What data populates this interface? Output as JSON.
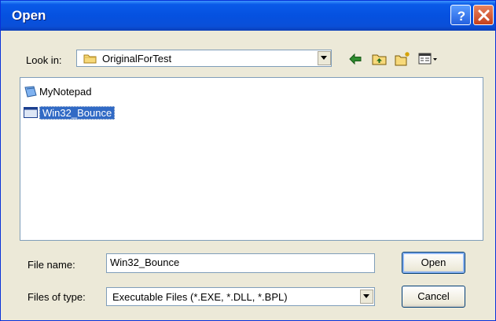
{
  "dialog": {
    "title": "Open",
    "look_in_label": "Look in:",
    "look_in_value": "OriginalForTest",
    "files": [
      {
        "name": "MyNotepad",
        "icon": "notepad-app-icon",
        "selected": false
      },
      {
        "name": "Win32_Bounce",
        "icon": "window-app-icon",
        "selected": true
      }
    ],
    "file_name_label": "File name:",
    "file_name_value": "Win32_Bounce",
    "file_type_label": "Files of type:",
    "file_type_value": "Executable Files (*.EXE, *.DLL, *.BPL)",
    "open_button": "Open",
    "cancel_button": "Cancel",
    "help_glyph": "?",
    "colors": {
      "title_bar": "#0551e0",
      "selection": "#316ac5",
      "window_bg": "#ece9d8"
    }
  }
}
